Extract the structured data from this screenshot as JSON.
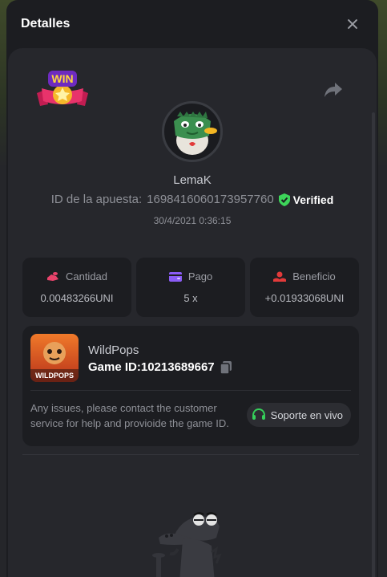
{
  "modal": {
    "title": "Detalles"
  },
  "bet": {
    "username": "LemaK",
    "id_label": "ID de la apuesta:",
    "id_value": "1698416060173957760",
    "verified_label": "Verified",
    "date": "30/4/2021 0:36:15",
    "badge_text": "WIN"
  },
  "stats": [
    {
      "label": "Cantidad",
      "value": "0.00483266UNI",
      "icon": "coins-icon"
    },
    {
      "label": "Pago",
      "value": "5 x",
      "icon": "wallet-icon"
    },
    {
      "label": "Beneficio",
      "value": "+0.01933068UNI",
      "icon": "profit-icon"
    }
  ],
  "game": {
    "name": "WildPops",
    "id_label": "Game ID:",
    "id_value": "10213689667",
    "thumb_text": "WILDPOPS",
    "help": "Any issues, please contact the customer service for help and provioide the game ID.",
    "support_label": "Soporte en vivo"
  },
  "colors": {
    "verified": "#3dd55a",
    "cantidad_icon": "#e8436b",
    "pago_icon": "#8b5cf6",
    "beneficio_icon": "#e23a3a",
    "support_icon": "#35d05a"
  }
}
